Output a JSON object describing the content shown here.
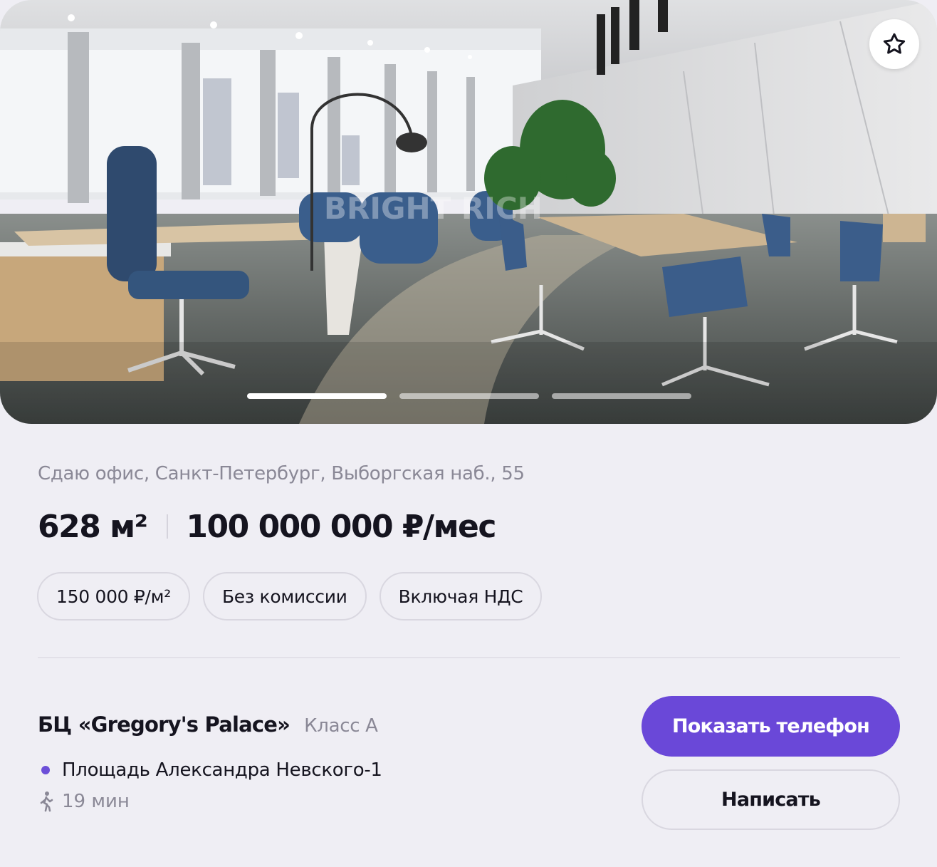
{
  "listing": {
    "address": "Сдаю офис, Санкт-Петербург, Выборгская наб., 55",
    "area": "628 м²",
    "price": "100 000 000 ₽/мес",
    "chips": [
      "150 000 ₽/м²",
      "Без комиссии",
      "Включая НДС"
    ]
  },
  "photo": {
    "watermark": "BRIGHT RICH",
    "slide_count": 3,
    "active_slide": 1
  },
  "building": {
    "name": "БЦ «Gregory's Palace»",
    "class": "Класс А"
  },
  "metro": {
    "station": "Площадь Александра Невского-1",
    "walk_time": "19 мин",
    "line_color": "#6c4fd8"
  },
  "actions": {
    "show_phone": "Показать телефон",
    "write": "Написать"
  },
  "icons": {
    "favorite": "star-outline-icon",
    "walk": "pedestrian-icon"
  },
  "colors": {
    "accent": "#6a48d8",
    "background": "#efeef4"
  }
}
